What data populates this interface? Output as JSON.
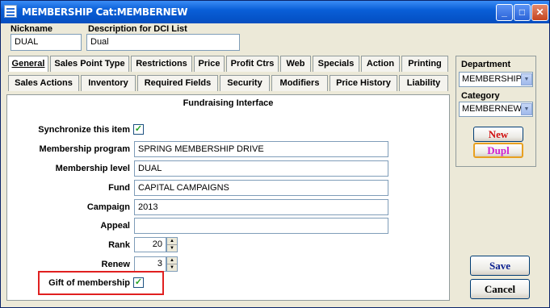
{
  "window": {
    "title": "MEMBERSHIP  Cat:MEMBERNEW",
    "controls": {
      "minimize": "_",
      "maximize": "□",
      "close": "✕"
    }
  },
  "header": {
    "nickname_label": "Nickname",
    "nickname_value": "DUAL",
    "description_label": "Description for DCI List",
    "description_value": "Dual"
  },
  "tabs_row1": [
    "General",
    "Sales Point Type",
    "Restrictions",
    "Price",
    "Profit Ctrs",
    "Web",
    "Specials",
    "Action",
    "Printing"
  ],
  "tabs_row2": [
    "Sales Actions",
    "Inventory",
    "Required Fields",
    "Security",
    "Modifiers",
    "Price History",
    "Liability"
  ],
  "active_tab": "General",
  "panel": {
    "section_title": "Fundraising Interface",
    "sync_label": "Synchronize this item",
    "sync_checked": "✓",
    "fields": {
      "program_label": "Membership program",
      "program_value": "SPRING MEMBERSHIP DRIVE",
      "level_label": "Membership level",
      "level_value": "DUAL",
      "fund_label": "Fund",
      "fund_value": "CAPITAL CAMPAIGNS",
      "campaign_label": "Campaign",
      "campaign_value": "2013",
      "appeal_label": "Appeal",
      "appeal_value": ""
    },
    "rank_label": "Rank",
    "rank_value": "20",
    "renew_label": "Renew",
    "renew_value": "3",
    "gift_label": "Gift of membership",
    "gift_checked": "✓"
  },
  "sidepanel": {
    "department_label": "Department",
    "department_value": "MEMBERSHIP",
    "category_label": "Category",
    "category_value": "MEMBERNEW",
    "new_label": "New",
    "dupl_label": "Dupl"
  },
  "actions": {
    "save_label": "Save",
    "cancel_label": "Cancel"
  },
  "colors": {
    "titlebar": "#0553C8",
    "new_text": "#D01010",
    "dupl_text": "#D020D0",
    "save_text": "#0A1F8F",
    "highlight_box": "#E02020"
  }
}
